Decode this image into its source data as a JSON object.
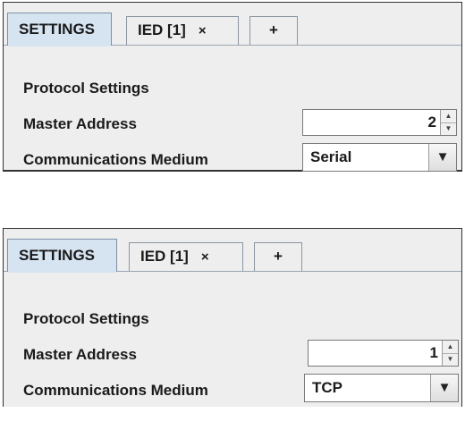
{
  "panels": [
    {
      "tabs": [
        {
          "label": "SETTINGS"
        },
        {
          "label": "IED [1]",
          "close_glyph": "×"
        },
        {
          "label": "+"
        }
      ],
      "section_title": "Protocol Settings",
      "master_address": {
        "label": "Master Address",
        "value": "2"
      },
      "communications_medium": {
        "label": "Communications Medium",
        "value": "Serial"
      }
    },
    {
      "tabs": [
        {
          "label": "SETTINGS"
        },
        {
          "label": "IED [1]",
          "close_glyph": "×"
        },
        {
          "label": "+"
        }
      ],
      "section_title": "Protocol Settings",
      "master_address": {
        "label": "Master Address",
        "value": "1"
      },
      "communications_medium": {
        "label": "Communications Medium",
        "value": "TCP"
      }
    }
  ],
  "icons": {
    "spinner_up": "triangle-up",
    "spinner_down": "triangle-down",
    "dropdown": "triangle-down"
  },
  "colors": {
    "active_tab": "#d6e4f2",
    "panel_bg": "#eeeeee"
  }
}
